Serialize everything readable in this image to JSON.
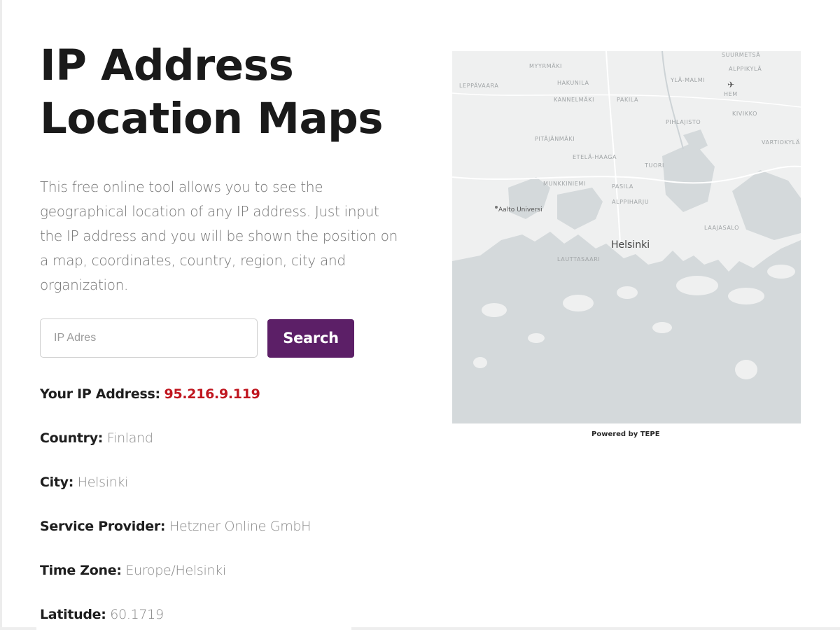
{
  "page": {
    "title": "IP Address\nLocation Maps",
    "intro": "This free online tool allows you to see the geographical location of any IP address. Just input the IP address and you will be shown the position on a map, coordinates, country, region, city and organization."
  },
  "search": {
    "placeholder": "IP Adres",
    "button_label": "Search",
    "button_color": "#5c1f67"
  },
  "info": {
    "ip": {
      "label": "Your IP Address:",
      "value": "95.216.9.119",
      "value_color": "#c0161f"
    },
    "country": {
      "label": "Country:",
      "value": "Finland"
    },
    "city": {
      "label": "City:",
      "value": "Helsinki"
    },
    "provider": {
      "label": "Service Provider:",
      "value": "Hetzner Online GmbH"
    },
    "timezone": {
      "label": "Time Zone:",
      "value": "Europe/Helsinki"
    },
    "latitude": {
      "label": "Latitude:",
      "value": "60.1719"
    }
  },
  "map": {
    "city_label": "Helsinki",
    "university_label": "Aalto Universi",
    "airport_label": "HEM",
    "district_labels": [
      "MYYRMÄKI",
      "HAKUNILA",
      "PAKILA",
      "YLÄ-MALMI",
      "SUURMETSÄ",
      "ALPPIKYLÄ",
      "KANNELMÄKI",
      "PIHLAJISTO",
      "PITÄJÄNMÄKI",
      "TUORI",
      "PASILA",
      "ALPPIHARJU",
      "LEPPÄVAARA",
      "VARTIOKYLÄ",
      "KIVIKKO",
      "LAAJASALO",
      "LAUTTASAARI",
      "ETELÄ-HAAGA",
      "MUNKKINIEMI"
    ],
    "credit": "Powered by TEPE",
    "water_color": "#d4d9db",
    "land_color": "#eff0f0"
  }
}
